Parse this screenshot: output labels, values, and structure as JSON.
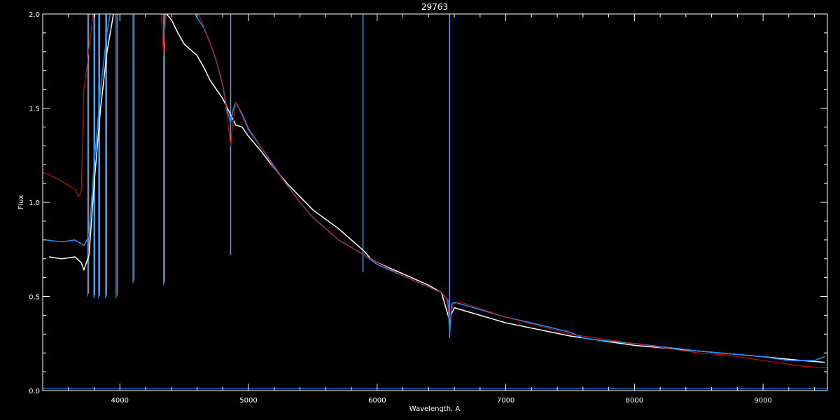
{
  "chart_data": {
    "type": "line",
    "title": "29763",
    "xlabel": "Wavelength, A",
    "ylabel": "Flux",
    "xlim": [
      3400,
      9500
    ],
    "ylim": [
      0.0,
      2.0
    ],
    "xticks": [
      4000,
      5000,
      6000,
      7000,
      8000,
      9000
    ],
    "xtick_labels": [
      "4000",
      "5000",
      "6000",
      "7000",
      "8000",
      "9000"
    ],
    "yticks": [
      0.0,
      0.5,
      1.0,
      1.5,
      2.0
    ],
    "ytick_labels": [
      "0.0",
      "0.5",
      "1.0",
      "1.5",
      "2.0"
    ],
    "grid": false,
    "legend": "none",
    "background": "#000000",
    "axis_color": "#ffffff",
    "series": [
      {
        "color": "#ffffff",
        "x": [
          3450,
          3550,
          3650,
          3700,
          3720,
          3760,
          3800,
          3850,
          3900,
          3950,
          4000,
          4100,
          4200,
          4300,
          4400,
          4450,
          4500,
          4600,
          4650,
          4700,
          4800,
          4850,
          4900,
          4950,
          5000,
          5100,
          5200,
          5300,
          5500,
          5700,
          5800,
          5900,
          5950,
          6000,
          6200,
          6400,
          6500,
          6560,
          6600,
          6700,
          7000,
          7500,
          7800,
          8000,
          8500,
          9000,
          9300,
          9480
        ],
        "y": [
          0.71,
          0.7,
          0.71,
          0.68,
          0.64,
          0.72,
          1.1,
          1.5,
          1.8,
          2.0,
          2.1,
          2.15,
          2.1,
          2.05,
          1.97,
          1.9,
          1.84,
          1.78,
          1.72,
          1.65,
          1.55,
          1.48,
          1.41,
          1.4,
          1.35,
          1.27,
          1.18,
          1.1,
          0.96,
          0.86,
          0.8,
          0.74,
          0.7,
          0.68,
          0.62,
          0.56,
          0.52,
          0.38,
          0.44,
          0.42,
          0.36,
          0.29,
          0.26,
          0.24,
          0.21,
          0.18,
          0.16,
          0.15
        ]
      },
      {
        "color": "#1e8fff",
        "x": [
          3420,
          3550,
          3650,
          3700,
          3720,
          3760,
          3800,
          3850,
          3900,
          3950,
          4000,
          4100,
          4200,
          4300,
          4400,
          4500,
          4550,
          4600,
          4650,
          4700,
          4750,
          4800,
          4830,
          4860,
          4880,
          4900,
          4950,
          5000,
          5100,
          5200,
          5300,
          5400,
          5500,
          5700,
          5900,
          6000,
          6200,
          6400,
          6500,
          6550,
          6563,
          6580,
          6600,
          6800,
          7000,
          7200,
          7500,
          7600,
          7700,
          8000,
          8500,
          9000,
          9200,
          9400,
          9480
        ],
        "y": [
          0.8,
          0.79,
          0.8,
          0.78,
          0.77,
          0.82,
          1.2,
          1.6,
          1.9,
          2.1,
          2.2,
          2.3,
          2.3,
          2.25,
          2.2,
          2.1,
          2.05,
          1.98,
          1.93,
          1.85,
          1.75,
          1.62,
          1.5,
          1.42,
          1.49,
          1.53,
          1.47,
          1.39,
          1.29,
          1.19,
          1.09,
          1.0,
          0.92,
          0.8,
          0.72,
          0.67,
          0.61,
          0.55,
          0.52,
          0.48,
          0.3,
          0.46,
          0.47,
          0.43,
          0.39,
          0.36,
          0.31,
          0.28,
          0.27,
          0.25,
          0.21,
          0.18,
          0.16,
          0.16,
          0.18
        ]
      },
      {
        "color": "#cc1111",
        "x": [
          3400,
          3500,
          3600,
          3650,
          3680,
          3700,
          3720,
          3750,
          3800,
          3850,
          3900,
          4000,
          4100,
          4200,
          4300,
          4320,
          4340,
          4360,
          4400,
          4500,
          4600,
          4700,
          4750,
          4800,
          4830,
          4850,
          4861,
          4875,
          4900,
          4950,
          5000,
          5100,
          5200,
          5300,
          5400,
          5500,
          5700,
          5900,
          6000,
          6200,
          6400,
          6500,
          6540,
          6563,
          6590,
          6650,
          7000,
          7500,
          8000,
          8500,
          8700,
          8900,
          9000,
          9200,
          9300,
          9500
        ],
        "y": [
          1.16,
          1.13,
          1.09,
          1.07,
          1.03,
          1.06,
          1.6,
          1.75,
          2.05,
          2.2,
          2.3,
          2.35,
          2.35,
          2.3,
          2.2,
          2.0,
          1.78,
          2.05,
          2.12,
          2.08,
          2.02,
          1.85,
          1.75,
          1.62,
          1.48,
          1.36,
          1.3,
          1.4,
          1.53,
          1.46,
          1.38,
          1.29,
          1.18,
          1.09,
          1.0,
          0.92,
          0.8,
          0.72,
          0.68,
          0.61,
          0.55,
          0.52,
          0.49,
          0.38,
          0.46,
          0.47,
          0.39,
          0.3,
          0.25,
          0.2,
          0.19,
          0.17,
          0.16,
          0.14,
          0.13,
          0.12
        ]
      }
    ],
    "absorption_dips": [
      {
        "x": 3750,
        "y": 0.5
      },
      {
        "x": 3798,
        "y": 0.49
      },
      {
        "x": 3835,
        "y": 0.49
      },
      {
        "x": 3889,
        "y": 0.49
      },
      {
        "x": 3970,
        "y": 0.49
      },
      {
        "x": 4102,
        "y": 0.57
      },
      {
        "x": 4340,
        "y": 0.56
      },
      {
        "x": 4861,
        "y": 0.72
      },
      {
        "x": 5890,
        "y": 0.63
      },
      {
        "x": 6563,
        "y": 0.28
      }
    ],
    "baseline_y": 0.01
  }
}
